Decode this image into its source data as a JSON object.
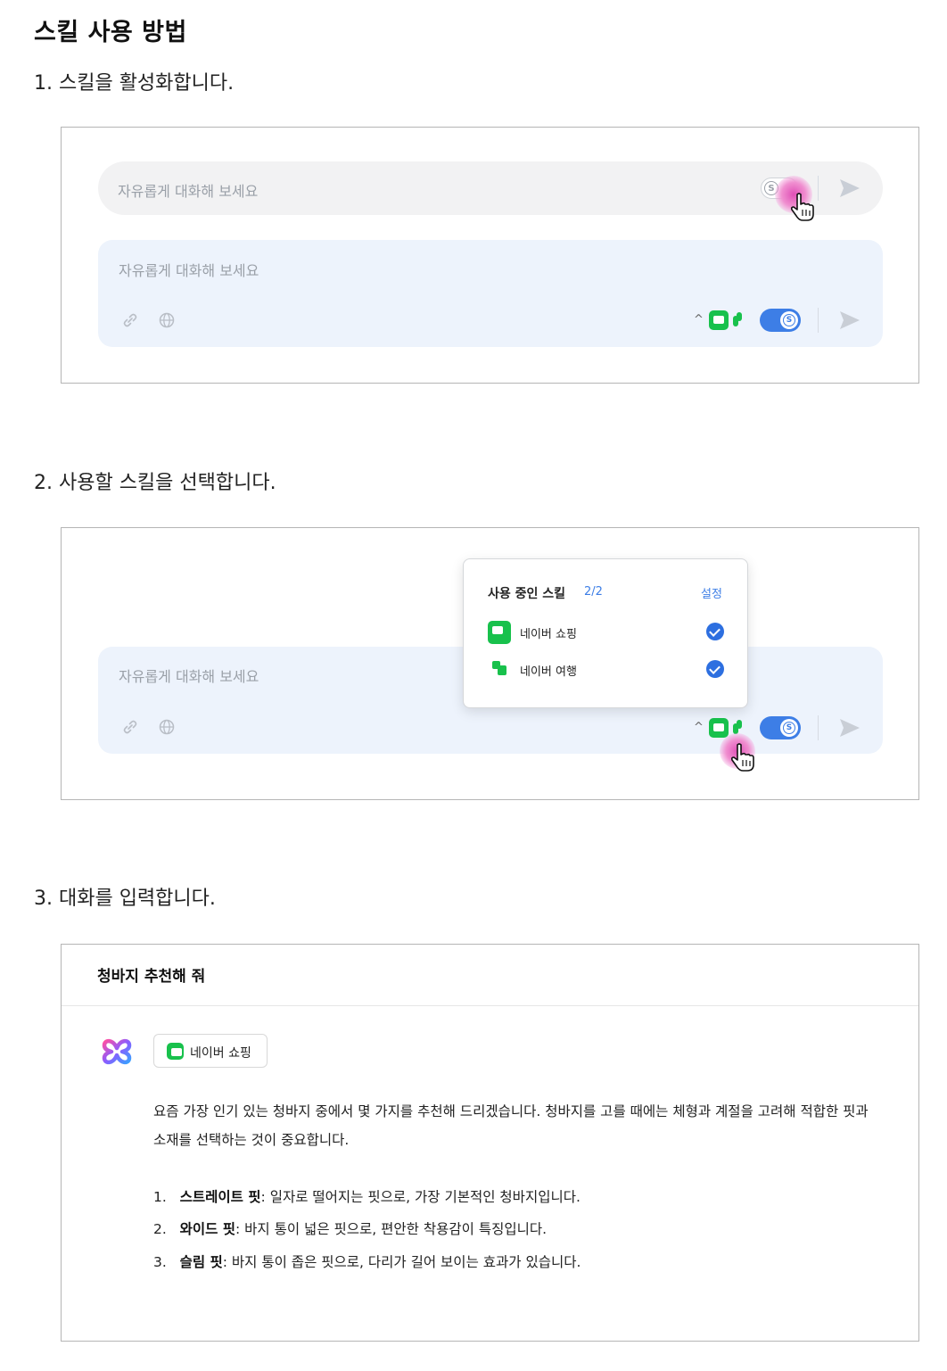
{
  "heading": "스킬 사용 방법",
  "steps": [
    "1. 스킬을 활성화합니다.",
    "2. 사용할 스킬을 선택합니다.",
    "3. 대화를 입력합니다."
  ],
  "input": {
    "placeholder": "자유롭게 대화해 보세요",
    "toggle_letter": "S"
  },
  "skill_popup": {
    "title": "사용 중인 스킬",
    "count": "2/2",
    "settings": "설정",
    "items": [
      {
        "label": "네이버 쇼핑",
        "checked": true,
        "icon": "shopping-icon"
      },
      {
        "label": "네이버 여행",
        "checked": true,
        "icon": "travel-icon"
      }
    ]
  },
  "chat": {
    "user_message": "청바지 추천해 줘",
    "skill_chip": "네이버 쇼핑",
    "answer": "요즘 가장 인기 있는 청바지 중에서 몇 가지를 추천해 드리겠습니다. 청바지를 고를 때에는 체형과 계절을 고려해 적합한 핏과 소재를 선택하는 것이 중요합니다.",
    "list": [
      {
        "num": "1.",
        "term": "스트레이트 핏",
        "desc": ": 일자로 떨어지는 핏으로, 가장 기본적인 청바지입니다."
      },
      {
        "num": "2.",
        "term": "와이드 핏",
        "desc": ": 바지 통이 넓은 핏으로, 편안한 착용감이 특징입니다."
      },
      {
        "num": "3.",
        "term": "슬림 핏",
        "desc": ": 바지 통이 좁은 핏으로, 다리가 길어 보이는 효과가 있습니다."
      }
    ]
  },
  "colors": {
    "accent": "#3d7ee6",
    "naver_green": "#18c14c",
    "cursor_highlight": "#e04fb6"
  }
}
